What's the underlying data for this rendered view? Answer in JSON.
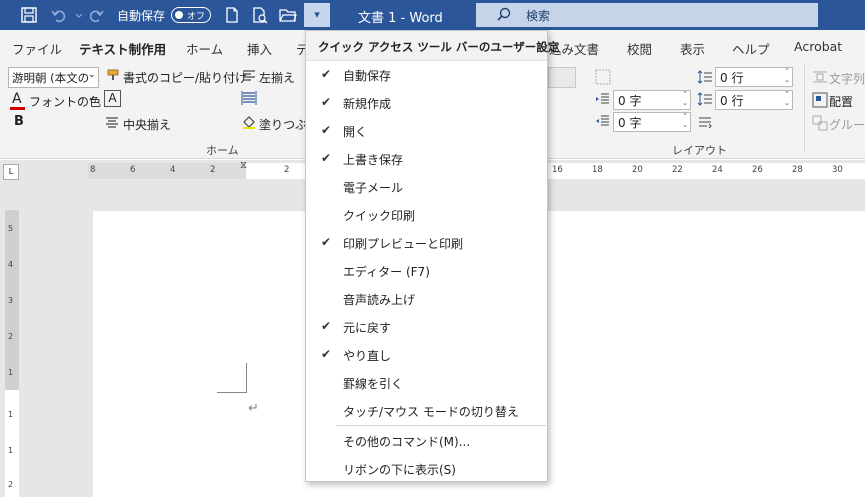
{
  "titlebar": {
    "autosave_label": "自動保存",
    "autosave_state": "オフ",
    "doc_title": "文書 1  -  Word",
    "search_label": "検索",
    "bg_color": "#2b579a"
  },
  "tabs": [
    "ファイル",
    "テキスト制作用",
    "ホーム",
    "挿入",
    "デ",
    "込み文書",
    "校閲",
    "表示",
    "ヘルプ",
    "Acrobat"
  ],
  "ribbon": {
    "font_name": "游明朝 (本文の",
    "format_painter": "書式のコピー/貼り付け",
    "align_left": "左揃え",
    "font_color": "フォントの色",
    "bold": "B",
    "center": "中央揃え",
    "fill": "塗りつぶし",
    "group_home": "ホーム",
    "indent_left": "0 字",
    "indent_right": "0 字",
    "indent_first": "0 字",
    "spacing_before": "0 行",
    "spacing_after": "0 行",
    "group_layout": "レイアウト",
    "wrap_text": "文字列",
    "position": "配置",
    "group_btn": "グルー"
  },
  "ruler": {
    "numbers": [
      "8",
      "6",
      "4",
      "2",
      "2",
      "16",
      "18",
      "20",
      "22",
      "24",
      "26",
      "28",
      "30"
    ]
  },
  "vruler": {
    "numbers": [
      "5",
      "4",
      "3",
      "2",
      "1",
      "1",
      "1",
      "2"
    ]
  },
  "menu": {
    "header": "クイック アクセス ツール バーのユーザー設定",
    "items": [
      {
        "label": "自動保存",
        "checked": true
      },
      {
        "label": "新規作成",
        "checked": true
      },
      {
        "label": "開く",
        "checked": true
      },
      {
        "label": "上書き保存",
        "checked": true
      },
      {
        "label": "電子メール",
        "checked": false
      },
      {
        "label": "クイック印刷",
        "checked": false
      },
      {
        "label": "印刷プレビューと印刷",
        "checked": true
      },
      {
        "label": "エディター (F7)",
        "checked": false
      },
      {
        "label": "音声読み上げ",
        "checked": false
      },
      {
        "label": "元に戻す",
        "checked": true
      },
      {
        "label": "やり直し",
        "checked": true
      },
      {
        "label": "罫線を引く",
        "checked": false
      },
      {
        "label": "タッチ/マウス モードの切り替え",
        "checked": false
      }
    ],
    "more_commands": "その他のコマンド(M)...",
    "show_below": "リボンの下に表示(S)",
    "check_glyph": "✔"
  }
}
